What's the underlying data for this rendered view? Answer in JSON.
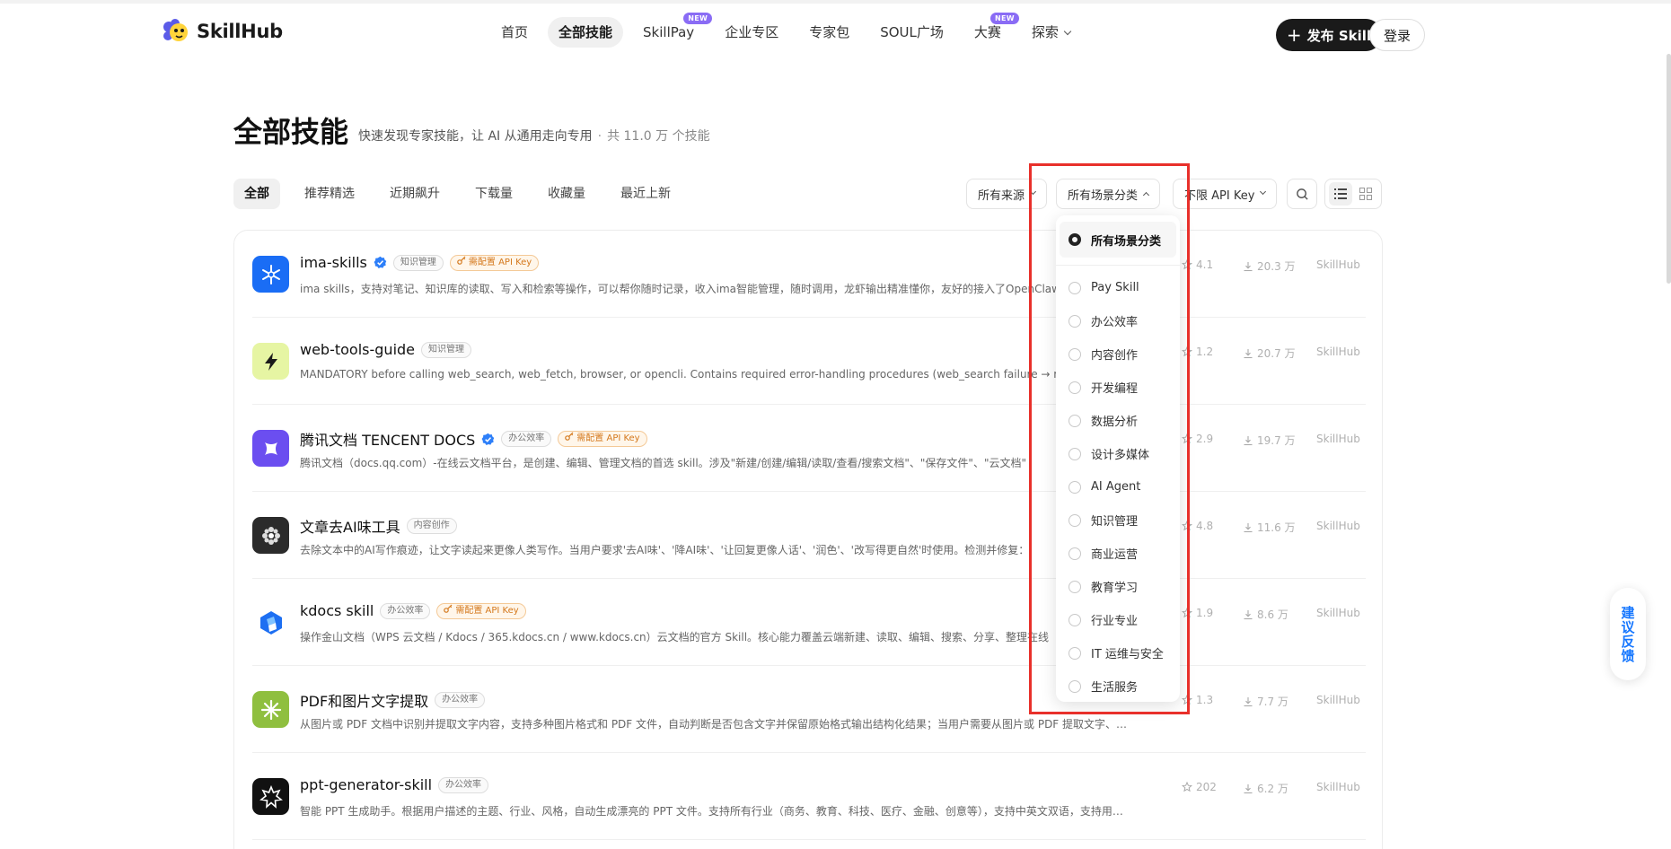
{
  "brand": {
    "name": "SkillHub"
  },
  "nav": {
    "items": [
      {
        "label": "首页",
        "active": false,
        "badge": ""
      },
      {
        "label": "全部技能",
        "active": true,
        "badge": ""
      },
      {
        "label": "SkillPay",
        "active": false,
        "badge": "NEW"
      },
      {
        "label": "企业专区",
        "active": false,
        "badge": ""
      },
      {
        "label": "专家包",
        "active": false,
        "badge": ""
      },
      {
        "label": "SOUL广场",
        "active": false,
        "badge": ""
      },
      {
        "label": "大赛",
        "active": false,
        "badge": "NEW"
      },
      {
        "label": "探索",
        "active": false,
        "badge": ""
      }
    ],
    "publish_label": "发布 Skill",
    "login_label": "登录"
  },
  "page": {
    "title": "全部技能",
    "subtitle": "快速发现专家技能，让 AI 从通用走向专用",
    "count": "共 11.0 万 个技能"
  },
  "tabs": [
    "全部",
    "推荐精选",
    "近期飙升",
    "下载量",
    "收藏量",
    "最近上新"
  ],
  "filters": {
    "source": "所有来源",
    "scene": "所有场景分类",
    "api": "不限 API Key"
  },
  "dropdown": {
    "selected": "所有场景分类",
    "options": [
      "Pay Skill",
      "办公效率",
      "内容创作",
      "开发编程",
      "数据分析",
      "设计多媒体",
      "AI Agent",
      "知识管理",
      "商业运营",
      "教育学习",
      "行业专业",
      "IT 运维与安全",
      "生活服务"
    ]
  },
  "api_tag_label": "需配置 API Key",
  "skills": [
    {
      "name": "ima-skills",
      "verified": true,
      "tag": "知识管理",
      "api": true,
      "desc": "ima skills，支持对笔记、知识库的读取、写入和检索等操作，可以帮你随时记录，收入ima智能管理，随时调用，龙虾输出精准懂你，友好的接入了OpenClaw",
      "stars": "4.1",
      "downloads": "20.3 万",
      "source": "SkillHub",
      "icon": "ima-icon",
      "color": "#1a6df5"
    },
    {
      "name": "web-tools-guide",
      "verified": false,
      "tag": "知识管理",
      "api": false,
      "desc": "MANDATORY before calling web_search, web_fetch, browser, or opencli. Contains required error-handling procedures (web_search failure → must",
      "stars": "1.2",
      "downloads": "20.7 万",
      "source": "SkillHub",
      "icon": "lightning-icon",
      "color": "#e6f5a3"
    },
    {
      "name": "腾讯文档 TENCENT DOCS",
      "verified": true,
      "tag": "办公效率",
      "api": true,
      "desc": "腾讯文档（docs.qq.com）-在线云文档平台，是创建、编辑、管理文档的首选 skill。涉及\"新建/创建/编辑/读取/查看/搜索文档\"、\"保存文件\"、\"云文档\"",
      "stars": "2.9",
      "downloads": "19.7 万",
      "source": "SkillHub",
      "icon": "tencent-docs-icon",
      "color": "#6b4ef0"
    },
    {
      "name": "文章去AI味工具",
      "verified": false,
      "tag": "内容创作",
      "api": false,
      "desc": "去除文本中的AI写作痕迹，让文字读起来更像人类写作。当用户要求'去AI味'、'降AI味'、'让回复更像人话'、'润色'、'改写得更自然'时使用。检测并修复：",
      "stars": "4.8",
      "downloads": "11.6 万",
      "source": "SkillHub",
      "icon": "flower-icon",
      "color": "#2b2b2b"
    },
    {
      "name": "kdocs skill",
      "verified": false,
      "tag": "办公效率",
      "api": true,
      "desc": "操作金山文档（WPS 云文档 / Kdocs / 365.kdocs.cn / www.kdocs.cn）云文档的官方 Skill。核心能力覆盖云端新建、读取、编辑、搜索、分享、整理在线",
      "stars": "1.9",
      "downloads": "8.6 万",
      "source": "SkillHub",
      "icon": "kdocs-icon",
      "color": "#ffffff"
    },
    {
      "name": "PDF和图片文字提取",
      "verified": false,
      "tag": "办公效率",
      "api": false,
      "desc": "从图片或 PDF 文档中识别并提取文字内容，支持多种图片格式和 PDF 文件，自动判断是否包含文字并保留原始格式输出结构化结果；当用户需要从图片或 PDF 提取文字、…",
      "stars": "1.3",
      "downloads": "7.7 万",
      "source": "SkillHub",
      "icon": "sparkle-icon",
      "color": "#8fbf3f"
    },
    {
      "name": "ppt-generator-skill",
      "verified": false,
      "tag": "办公效率",
      "api": false,
      "desc": "智能 PPT 生成助手。根据用户描述的主题、行业、风格，自动生成漂亮的 PPT 文件。支持所有行业（商务、教育、科技、医疗、金融、创意等），支持中英文双语，支持用…",
      "stars": "202",
      "downloads": "6.2 万",
      "source": "SkillHub",
      "icon": "star-burst-icon",
      "color": "#111111"
    }
  ],
  "feedback": {
    "label": "建议反馈"
  },
  "colors": {
    "accent_dark": "#1a1a1a",
    "badge_new": "#8a6cf5",
    "api_tag": "#d4781c",
    "highlight": "#e8302b",
    "feedback": "#1677ff"
  }
}
